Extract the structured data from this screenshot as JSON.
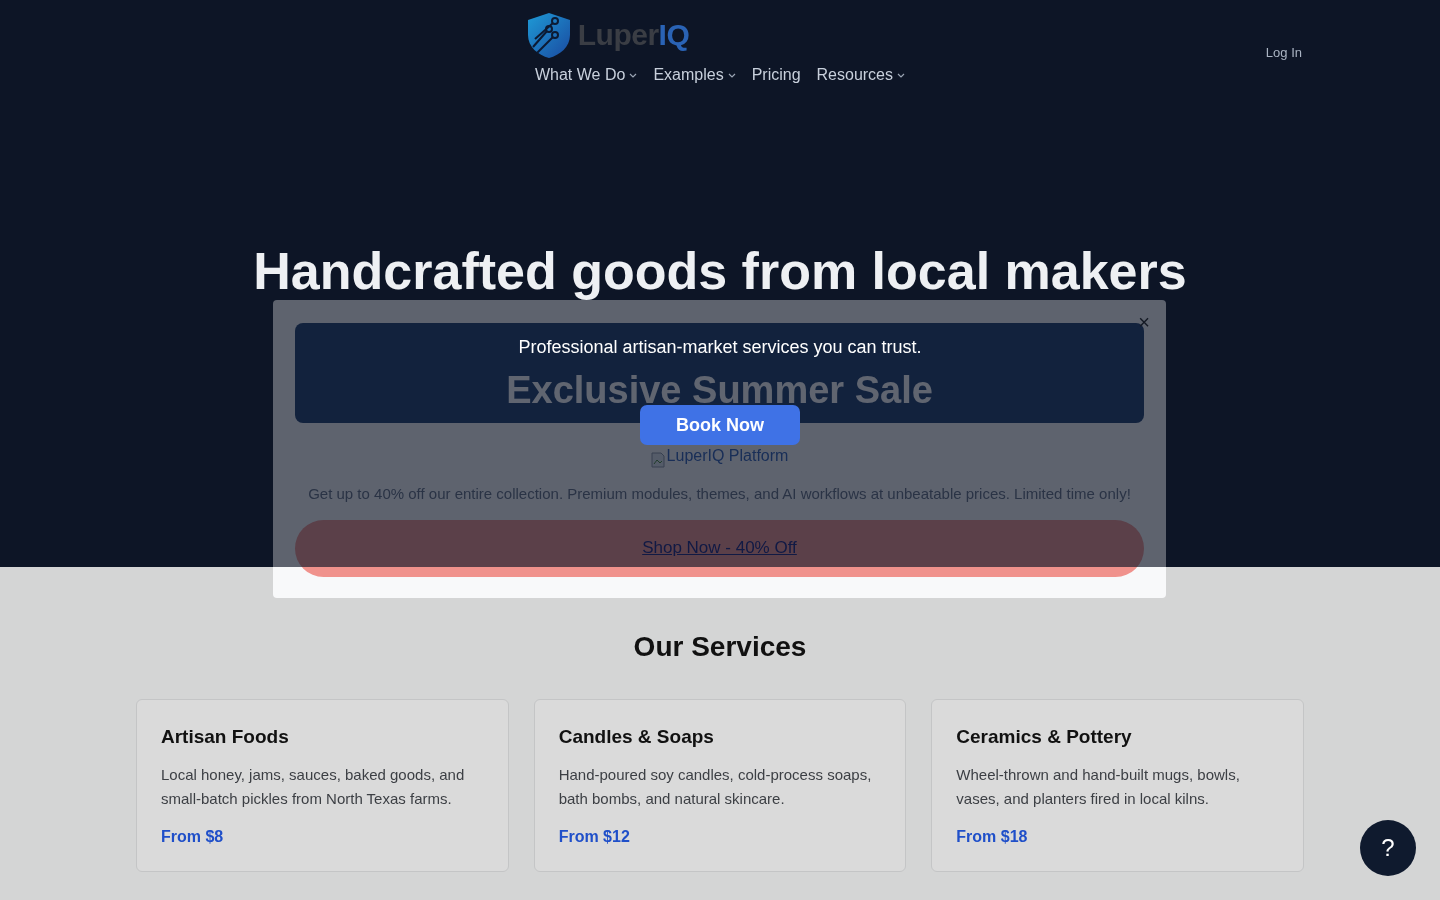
{
  "logo": {
    "name": "Luper",
    "accent": "IQ"
  },
  "nav": [
    {
      "label": "What We Do",
      "has_menu": true
    },
    {
      "label": "Examples",
      "has_menu": true
    },
    {
      "label": "Pricing",
      "has_menu": false
    },
    {
      "label": "Resources",
      "has_menu": true
    }
  ],
  "login": "Log In",
  "hero": {
    "title": "Handcrafted goods from local makers",
    "subtitle": "Professional artisan-market services you can trust.",
    "button": "Book Now"
  },
  "modal": {
    "close": "×",
    "heading": "Exclusive Summer Sale",
    "image_alt": "LuperIQ Platform",
    "description": "Get up to 40% off our entire collection. Premium modules, themes, and AI workflows at unbeatable prices. Limited time only!",
    "button": "Shop Now - 40% Off"
  },
  "services": {
    "title": "Our Services",
    "cards": [
      {
        "title": "Artisan Foods",
        "text": "Local honey, jams, sauces, baked goods, and small-batch pickles from North Texas farms.",
        "price": "From $8"
      },
      {
        "title": "Candles & Soaps",
        "text": "Hand-poured soy candles, cold-process soaps, bath bombs, and natural skincare.",
        "price": "From $12"
      },
      {
        "title": "Ceramics & Pottery",
        "text": "Wheel-thrown and hand-built mugs, bowls, vases, and planters fired in local kilns.",
        "price": "From $18"
      }
    ]
  },
  "help": "?"
}
